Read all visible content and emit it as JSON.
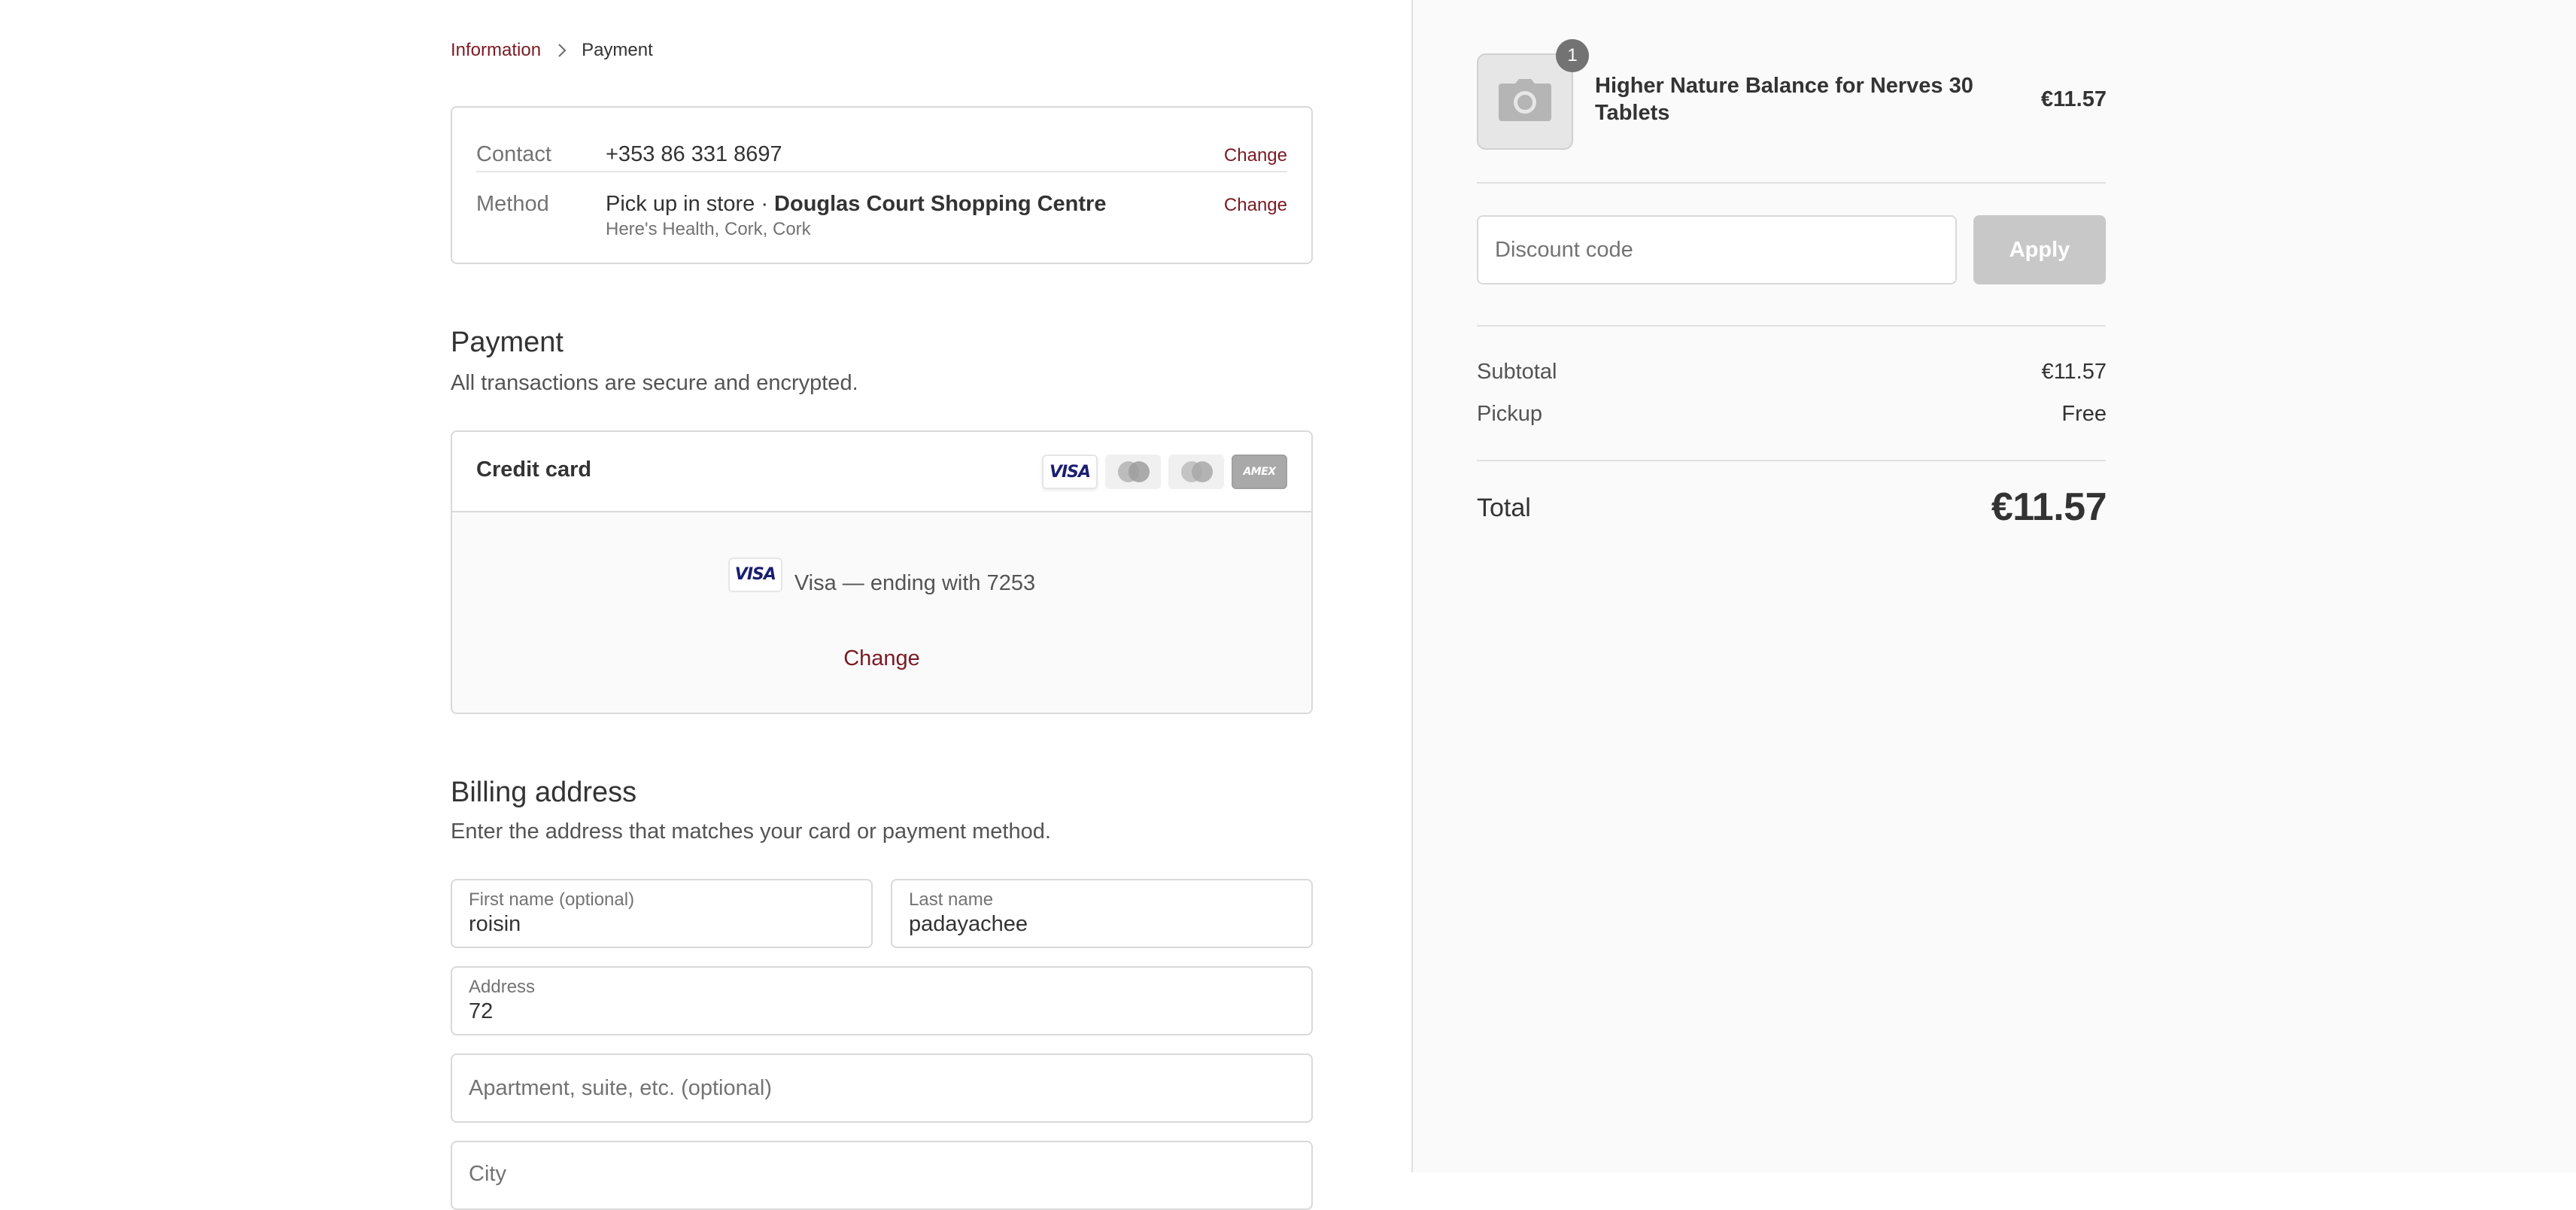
{
  "breadcrumb": {
    "items": [
      {
        "label": "Information"
      },
      {
        "label": "Payment"
      }
    ]
  },
  "review": {
    "contact": {
      "label": "Contact",
      "value": "+353 86 331 8697",
      "change_label": "Change"
    },
    "method": {
      "label": "Method",
      "value_prefix": "Pick up in store · ",
      "value_store": "Douglas Court Shopping Centre",
      "sub": "Here's Health, Cork, Cork",
      "change_label": "Change"
    }
  },
  "payment": {
    "title": "Payment",
    "subtitle": "All transactions are secure and encrypted.",
    "method_label": "Credit card",
    "card_icons": [
      {
        "icon": "visa-icon",
        "label": "VISA"
      },
      {
        "icon": "mastercard-icon"
      },
      {
        "icon": "maestro-icon"
      },
      {
        "icon": "amex-icon",
        "label": "AMEX"
      }
    ],
    "saved_card": {
      "brand_label": "VISA",
      "text": "Visa — ending with 7253",
      "change_label": "Change"
    }
  },
  "billing": {
    "title": "Billing address",
    "subtitle": "Enter the address that matches your card or payment method.",
    "fields": {
      "first_name": {
        "label": "First name (optional)",
        "value": "roisin"
      },
      "last_name": {
        "label": "Last name",
        "value": "padayachee"
      },
      "address": {
        "label": "Address",
        "value": "72"
      },
      "apartment": {
        "placeholder": "Apartment, suite, etc. (optional)"
      },
      "city": {
        "label": "City"
      }
    }
  },
  "summary": {
    "product": {
      "name": "Higher Nature Balance for Nerves 30 Tablets",
      "quantity": "1",
      "price": "€11.57",
      "thumbnail_icon": "camera-icon"
    },
    "discount": {
      "placeholder": "Discount code",
      "apply_label": "Apply"
    },
    "subtotal": {
      "label": "Subtotal",
      "value": "€11.57"
    },
    "pickup": {
      "label": "Pickup",
      "value": "Free"
    },
    "total": {
      "label": "Total",
      "value": "€11.57"
    }
  },
  "colors": {
    "accent": "#7a1a23",
    "text": "#333333",
    "muted": "#737373",
    "border": "#d9d9d9",
    "sidebar_bg": "#fafafa"
  }
}
